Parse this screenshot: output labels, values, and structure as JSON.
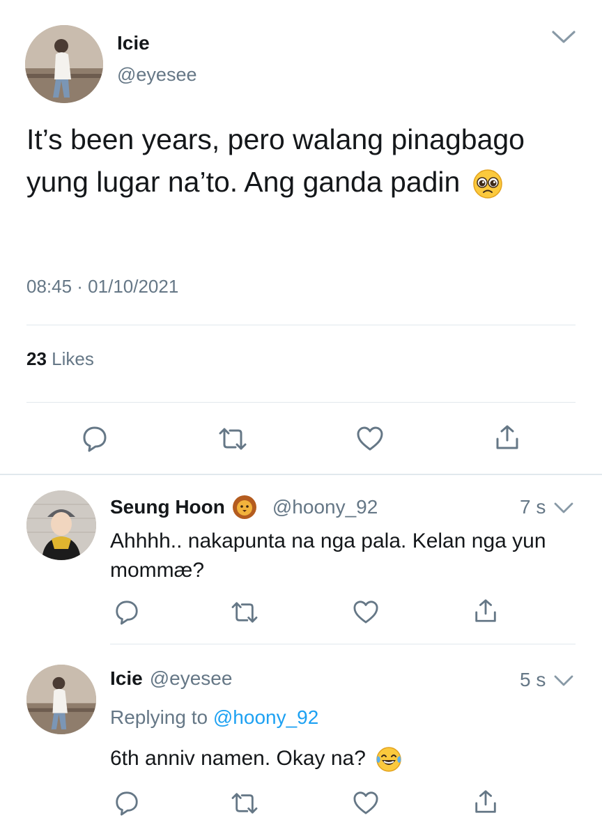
{
  "tweet": {
    "author_name": "Icie",
    "author_handle": "@eyesee",
    "text": "It’s been years, pero walang pinagbago yung lugar na’to. Ang ganda padin",
    "text_emoji": "pleading-face-emoji",
    "timestamp": "08:45 · 01/10/2021",
    "likes_count": "23",
    "likes_label": "Likes"
  },
  "replies": [
    {
      "author_name": "Seung Hoon",
      "name_emoji": "lion-face-emoji",
      "author_handle": "@hoony_92",
      "time": "7 s",
      "text": "Ahhhh.. nakapunta na nga pala. Kelan nga yun mommæ?"
    },
    {
      "author_name": "Icie",
      "author_handle": "@eyesee",
      "time": "5 s",
      "replying_label": "Replying to",
      "replying_handle": "@hoony_92",
      "text": "6th anniv namen. Okay na?",
      "text_emoji": "tears-of-joy-emoji"
    }
  ],
  "colors": {
    "link": "#1da1f2",
    "secondary_text": "#657786",
    "divider": "#e1e8ed"
  }
}
